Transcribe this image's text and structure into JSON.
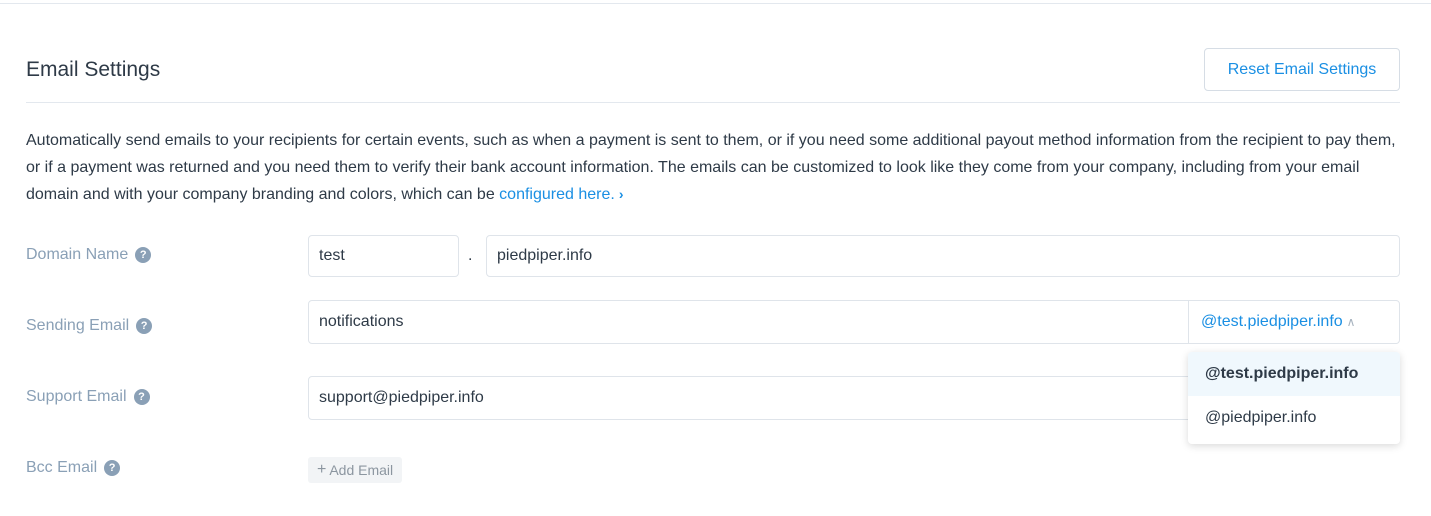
{
  "header": {
    "title": "Email Settings",
    "reset_button_label": "Reset Email Settings"
  },
  "description": {
    "text": "Automatically send emails to your recipients for certain events, such as when a payment is sent to them, or if you need some additional payout method information from the recipient to pay them, or if a payment was returned and you need them to verify their bank account information. The emails can be customized to look like they come from your company, including from your email domain and with your company branding and colors, which can be ",
    "link_text": "configured here.",
    "link_chevron": "›"
  },
  "fields": {
    "domain_name": {
      "label": "Domain Name",
      "subdomain_value": "test",
      "separator": ".",
      "domain_value": "piedpiper.info"
    },
    "sending_email": {
      "label": "Sending Email",
      "local_part_value": "notifications",
      "selected_suffix": "@test.piedpiper.info",
      "suffix_options": [
        "@test.piedpiper.info",
        "@piedpiper.info"
      ]
    },
    "support_email": {
      "label": "Support Email",
      "value": "support@piedpiper.info"
    },
    "bcc_email": {
      "label": "Bcc Email",
      "add_button_label": "Add Email"
    }
  },
  "icons": {
    "help": "help-circle-icon",
    "chevron": "chevron-right-icon",
    "caret": "caret-up-icon",
    "plus": "plus-icon"
  },
  "colors": {
    "accent": "#1a8fe3",
    "label": "#8aa0b6",
    "text": "#2e3a47",
    "selected_option_bg": "#f0f8fd"
  }
}
